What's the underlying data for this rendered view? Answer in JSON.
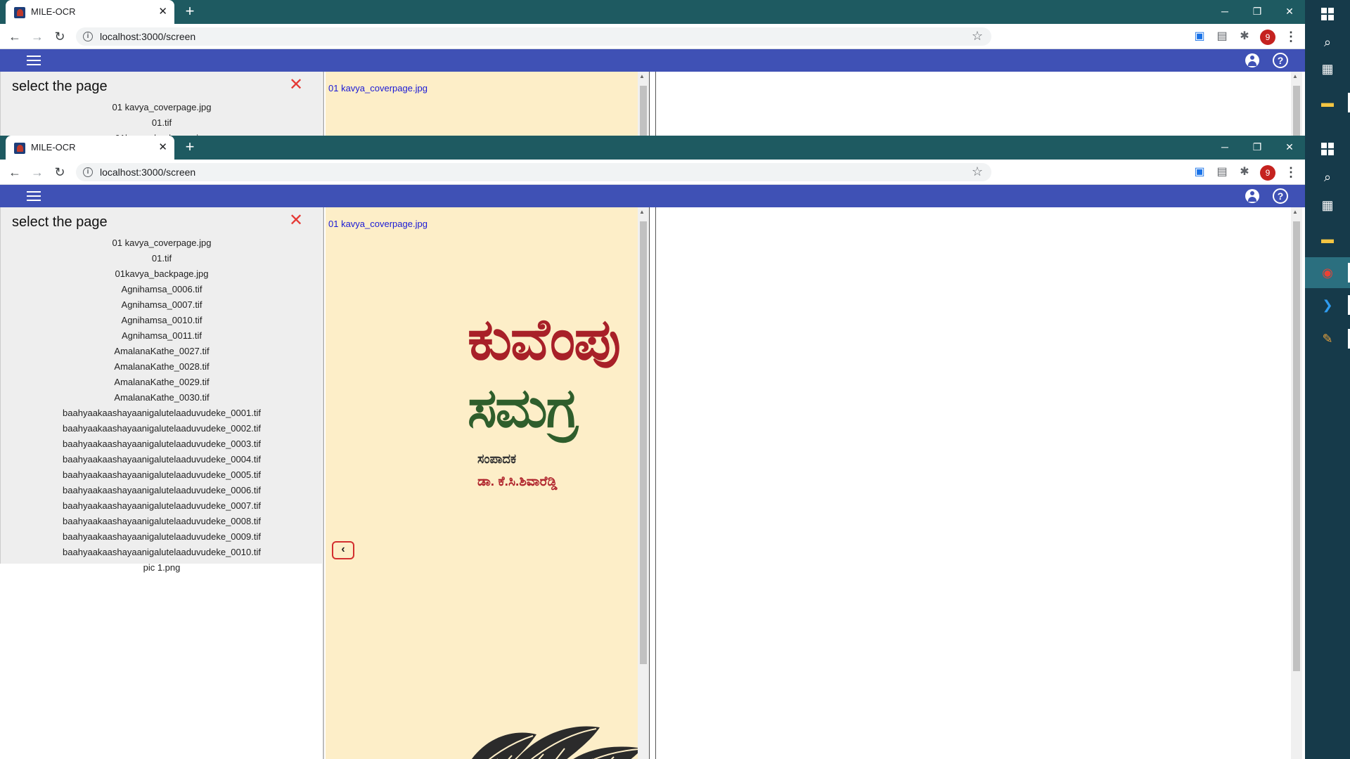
{
  "browser": {
    "tab_title": "MILE-OCR",
    "tab_close": "✕",
    "new_tab": "+",
    "url": "localhost:3000/screen",
    "profile_initial": "9",
    "window_controls": {
      "minimize": "─",
      "restore": "❐",
      "close": "✕"
    }
  },
  "left_panel": {
    "title": "select the page",
    "close_glyph": "✕",
    "files": [
      "01 kavya_coverpage.jpg",
      "01.tif",
      "01kavya_backpage.jpg",
      "Agnihamsa_0006.tif",
      "Agnihamsa_0007.tif",
      "Agnihamsa_0010.tif",
      "Agnihamsa_0011.tif",
      "AmalanaKathe_0027.tif",
      "AmalanaKathe_0028.tif",
      "AmalanaKathe_0029.tif",
      "AmalanaKathe_0030.tif",
      "baahyaakaashayaanigalutelaaduvudeke_0001.tif",
      "baahyaakaashayaanigalutelaaduvudeke_0002.tif",
      "baahyaakaashayaanigalutelaaduvudeke_0003.tif",
      "baahyaakaashayaanigalutelaaduvudeke_0004.tif",
      "baahyaakaashayaanigalutelaaduvudeke_0005.tif",
      "baahyaakaashayaanigalutelaaduvudeke_0006.tif",
      "baahyaakaashayaanigalutelaaduvudeke_0007.tif",
      "baahyaakaashayaanigalutelaaduvudeke_0008.tif",
      "baahyaakaashayaanigalutelaaduvudeke_0009.tif",
      "baahyaakaashayaanigalutelaaduvudeke_0010.tif",
      "pic 1.png"
    ]
  },
  "viewer": {
    "image_name": "01 kavya_coverpage.jpg",
    "cover_title_line1": "ಕುವೆಂಪು",
    "cover_title_line2": "ಸಮಗ್ರ",
    "editor_label": "ಸಂಪಾದಕ",
    "editor_name": "ಡಾ. ಕೆ.ಸಿ.ಶಿವಾರೆಡ್ಡಿ",
    "prev_glyph": "‹"
  },
  "colors": {
    "app_bar": "#3f51b5",
    "tab_strip": "#1e5a61",
    "viewer_bg": "#fdeec8",
    "close_red": "#e53935",
    "link_blue": "#1a1ad6"
  },
  "icons": {
    "back": "←",
    "forward": "→",
    "reload": "↻",
    "star": "☆",
    "extensions": "✱",
    "help": "?"
  }
}
